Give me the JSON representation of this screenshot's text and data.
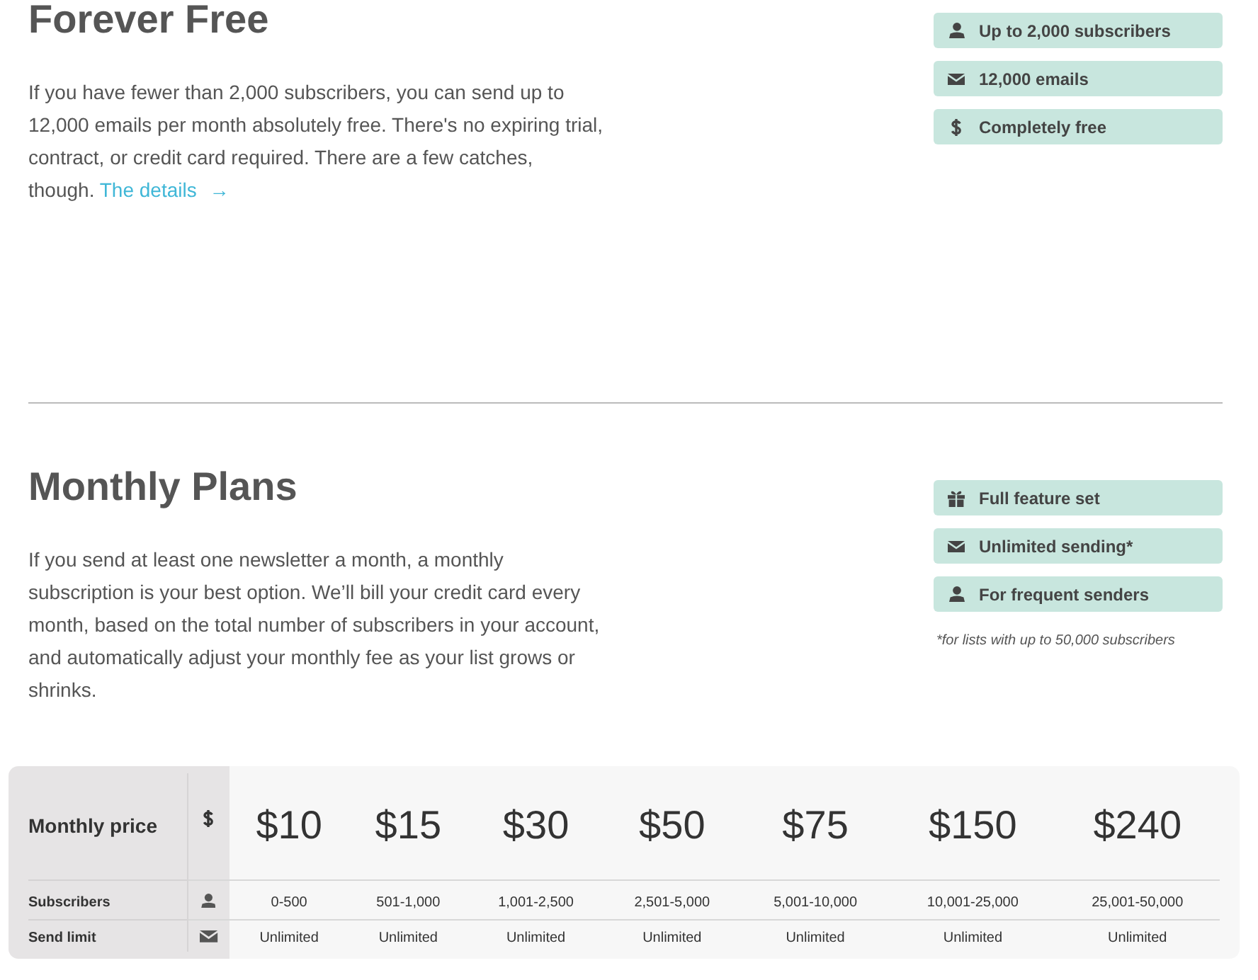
{
  "sections": [
    {
      "title": "Forever Free",
      "description": "If you have fewer than 2,000 subscribers, you can send up to 12,000 emails per month absolutely free. There's no expiring trial, contract, or credit card required. There are a few catches, though.",
      "link": {
        "label": "The details",
        "arrow": "→"
      },
      "features": [
        {
          "kind": "subscribers",
          "label": "Up to 2,000 subscribers"
        },
        {
          "kind": "emails",
          "label": "12,000 emails"
        },
        {
          "kind": "price",
          "label": "Completely free"
        }
      ]
    },
    {
      "title": "Monthly Plans",
      "description": "If you send at least one newsletter a month, a monthly subscription is your best option. We’ll bill your credit card every month, based on the total number of subscribers in your account, and automatically adjust your monthly fee as your list grows or shrinks.",
      "features": [
        {
          "kind": "features",
          "label": "Full feature set"
        },
        {
          "kind": "emails",
          "label": "Unlimited sending*"
        },
        {
          "kind": "subscribers",
          "label": "For frequent senders"
        }
      ],
      "footnote": "*for lists with up to 50,000 subscribers"
    }
  ],
  "pricing_table": {
    "rows": [
      {
        "kind": "price",
        "label": "Monthly price",
        "cells": [
          "$10",
          "$15",
          "$30",
          "$50",
          "$75",
          "$150",
          "$240"
        ]
      },
      {
        "kind": "subscribers",
        "label": "Subscribers",
        "cells": [
          "0-500",
          "501-1,000",
          "1,001-2,500",
          "2,501-5,000",
          "5,001-10,000",
          "10,001-25,000",
          "25,001-50,000"
        ]
      },
      {
        "kind": "emails",
        "label": "Send limit",
        "cells": [
          "Unlimited",
          "Unlimited",
          "Unlimited",
          "Unlimited",
          "Unlimited",
          "Unlimited",
          "Unlimited"
        ]
      }
    ]
  }
}
